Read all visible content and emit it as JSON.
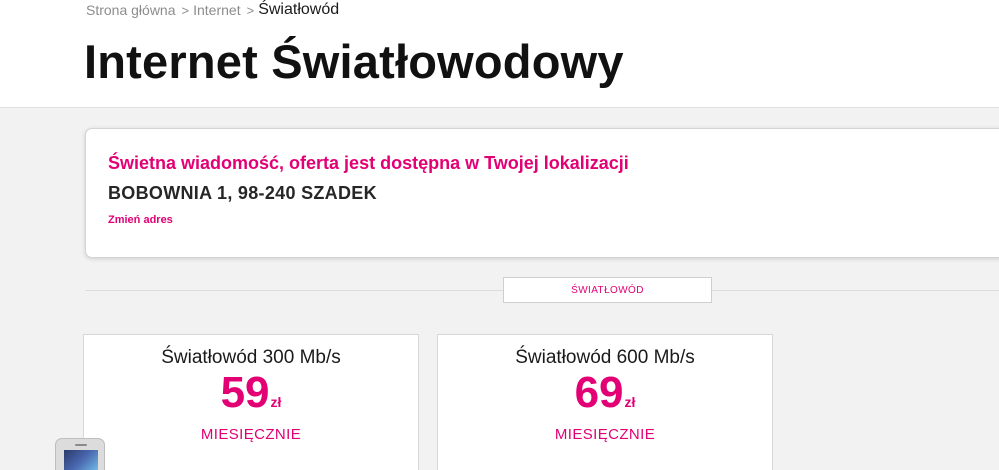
{
  "breadcrumb": {
    "home": "Strona główna",
    "separator_icon": "chevron-right-icon",
    "sep1": ">",
    "internet": "Internet",
    "sep2": ">",
    "current": "Światłowód"
  },
  "page": {
    "title": "Internet Światłowodowy"
  },
  "address": {
    "headline": "Świetna wiadomość, oferta jest dostępna w Twojej lokalizacji",
    "line": "BOBOWNIA 1, 98-240 SZADEK",
    "change_link": "Zmień adres"
  },
  "tabs": [
    {
      "label": "ŚWIATŁOWÓD"
    }
  ],
  "plans": [
    {
      "name": "Światłowód 300 Mb/s",
      "price": "59",
      "currency": "zł",
      "period": "MIESIĘCZNIE"
    },
    {
      "name": "Światłowód 600 Mb/s",
      "price": "69",
      "currency": "zł",
      "period": "MIESIĘCZNIE"
    }
  ],
  "colors": {
    "brand_magenta": "#e20074",
    "background": "#f2f2f2"
  },
  "icons": {
    "phone": "smartphone-icon"
  }
}
